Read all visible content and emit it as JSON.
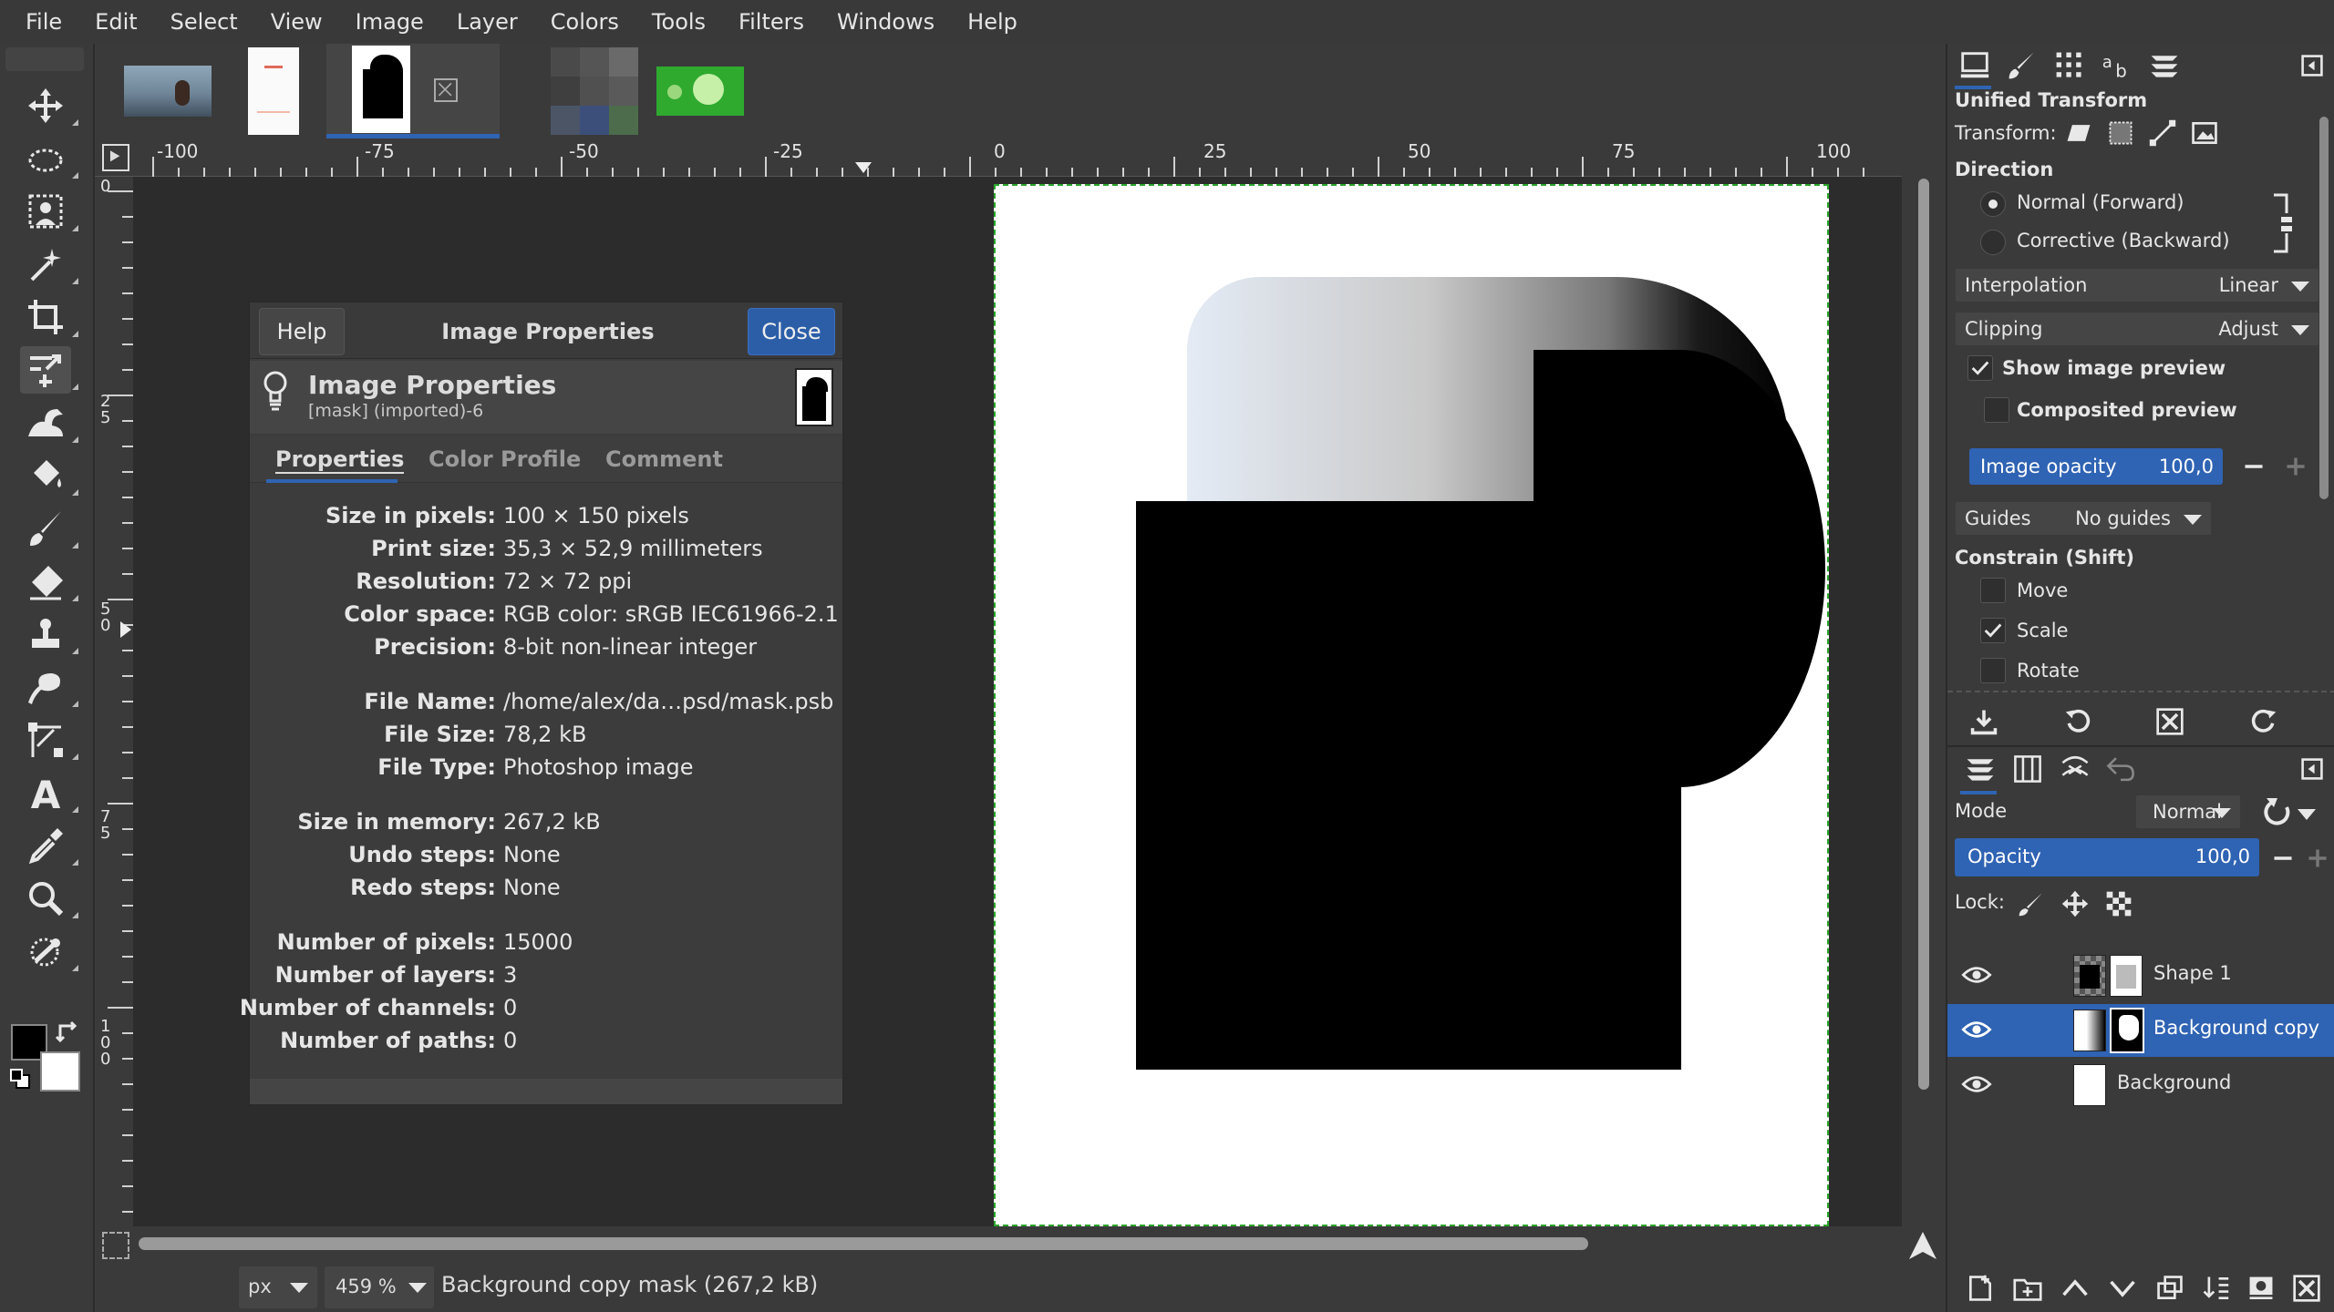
{
  "menubar": [
    "File",
    "Edit",
    "Select",
    "View",
    "Image",
    "Layer",
    "Colors",
    "Tools",
    "Filters",
    "Windows",
    "Help"
  ],
  "toolbox": {
    "tools": [
      "move-tool-icon",
      "ellipse-select-icon",
      "foreground-select-icon",
      "fuzzy-select-icon",
      "crop-icon",
      "unified-transform-icon",
      "warp-transform-icon",
      "bucket-fill-icon",
      "paintbrush-icon",
      "eraser-icon",
      "clone-icon",
      "smudge-icon",
      "paths-icon",
      "text-icon",
      "color-picker-icon",
      "zoom-icon",
      "dodge-burn-icon"
    ],
    "fg_color": "#000000",
    "bg_color": "#ffffff"
  },
  "ruler": {
    "h_labels": [
      "-100",
      "-75",
      "-50",
      "-25",
      "0",
      "25",
      "50",
      "75",
      "100"
    ],
    "v_labels": [
      "0",
      "25",
      "50",
      "75",
      "100"
    ]
  },
  "dialog": {
    "help_label": "Help",
    "title": "Image Properties",
    "close_label": "Close",
    "header_title": "Image Properties",
    "header_sub": "[mask] (imported)-6",
    "tabs": [
      "Properties",
      "Color Profile",
      "Comment"
    ],
    "rows": [
      {
        "k": "Size in pixels:",
        "v": "100 × 150 pixels"
      },
      {
        "k": "Print size:",
        "v": "35,3 × 52,9 millimeters"
      },
      {
        "k": "Resolution:",
        "v": "72 × 72 ppi"
      },
      {
        "k": "Color space:",
        "v": "RGB color: sRGB IEC61966-2.1"
      },
      {
        "k": "Precision:",
        "v": "8-bit non-linear integer"
      },
      {
        "k": "File Name:",
        "v": "/home/alex/da…psd/mask.psb"
      },
      {
        "k": "File Size:",
        "v": "78,2 kB"
      },
      {
        "k": "File Type:",
        "v": "Photoshop image"
      },
      {
        "k": "Size in memory:",
        "v": "267,2 kB"
      },
      {
        "k": "Undo steps:",
        "v": "None"
      },
      {
        "k": "Redo steps:",
        "v": "None"
      },
      {
        "k": "Number of pixels:",
        "v": "15000"
      },
      {
        "k": "Number of layers:",
        "v": "3"
      },
      {
        "k": "Number of channels:",
        "v": "0"
      },
      {
        "k": "Number of paths:",
        "v": "0"
      }
    ]
  },
  "status": {
    "unit": "px",
    "zoom": "459 %",
    "text": "Background copy mask (267,2 kB)"
  },
  "tool_options": {
    "title": "Unified Transform",
    "transform_label": "Transform:",
    "direction_label": "Direction",
    "direction_options": [
      "Normal (Forward)",
      "Corrective (Backward)"
    ],
    "direction_selected": "Normal (Forward)",
    "interpolation_label": "Interpolation",
    "interpolation_value": "Linear",
    "clipping_label": "Clipping",
    "clipping_value": "Adjust",
    "show_preview_label": "Show image preview",
    "show_preview": true,
    "composited_label": "Composited preview",
    "composited": false,
    "opacity_label": "Image opacity",
    "opacity_value": "100,0",
    "guides_label": "Guides",
    "guides_value": "No guides",
    "constrain_label": "Constrain (Shift)",
    "constrain": [
      {
        "label": "Move",
        "checked": false
      },
      {
        "label": "Scale",
        "checked": true
      },
      {
        "label": "Rotate",
        "checked": false
      }
    ]
  },
  "layers": {
    "mode_label": "Mode",
    "mode_value": "Normal",
    "opacity_label": "Opacity",
    "opacity_value": "100,0",
    "lock_label": "Lock:",
    "items": [
      {
        "name": "Shape 1",
        "selected": false
      },
      {
        "name": "Background copy",
        "selected": true
      },
      {
        "name": "Background",
        "selected": false
      }
    ]
  },
  "colors": {
    "accent": "#2f63b3"
  }
}
